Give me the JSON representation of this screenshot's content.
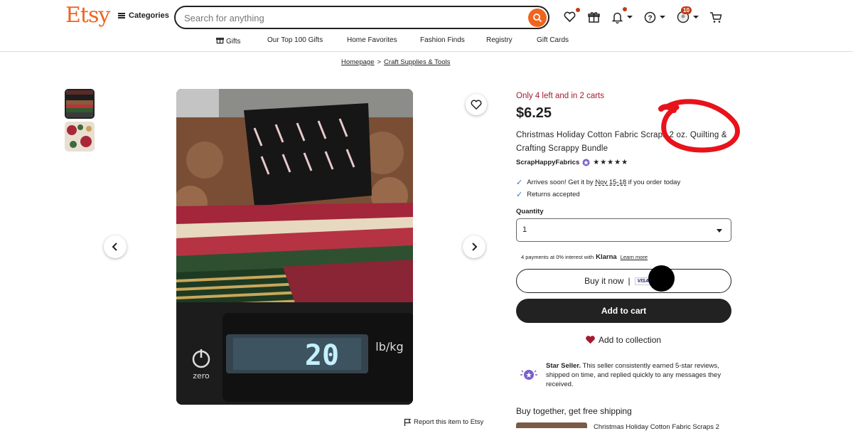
{
  "header": {
    "logo": "Etsy",
    "categories_label": "Categories",
    "search_placeholder": "Search for anything",
    "cart_badge": "10"
  },
  "subnav": {
    "items": [
      "Gifts",
      "Our Top 100 Gifts",
      "Home Favorites",
      "Fashion Finds",
      "Registry",
      "Gift Cards"
    ]
  },
  "breadcrumb": {
    "items": [
      "Homepage",
      "Craft Supplies & Tools"
    ],
    "separator": ">"
  },
  "product": {
    "stock_note": "Only 4 left and in 2 carts",
    "price": "$6.25",
    "title": "Christmas Holiday Cotton Fabric Scraps 2 oz. Quilting & Crafting Scrappy Bundle",
    "seller": "ScrapHappyFabrics",
    "rating_stars": "★★★★★",
    "arrives_prefix": "Arrives soon! Get it by",
    "arrives_date": "Nov 15-18",
    "arrives_suffix": "if you order today",
    "returns": "Returns accepted",
    "quantity_label": "Quantity",
    "quantity_value": "1",
    "klarna_text": "4 payments at 0% interest with",
    "klarna_brand": "Klarna",
    "klarna_link": "Learn more",
    "buy_now": "Buy it now",
    "buy_sep": "|",
    "visa": "VISA",
    "buy_more": "...",
    "add_to_cart": "Add to cart",
    "add_to_collection": "Add to collection",
    "star_seller_title": "Star Seller.",
    "star_seller_text": "This seller consistently earned 5-star reviews, shipped on time, and replied quickly to any messages they received.",
    "buy_together": "Buy together, get free shipping",
    "bt_item": "Christmas Holiday Cotton Fabric Scraps 2"
  },
  "image": {
    "scale_reading": "20",
    "unit": "lb/kg",
    "zero_label": "zero",
    "report": "Report this item to Etsy"
  },
  "colors": {
    "brand": "#f1641e",
    "stock": "#a61a2e",
    "annotation": "#e8121b"
  }
}
